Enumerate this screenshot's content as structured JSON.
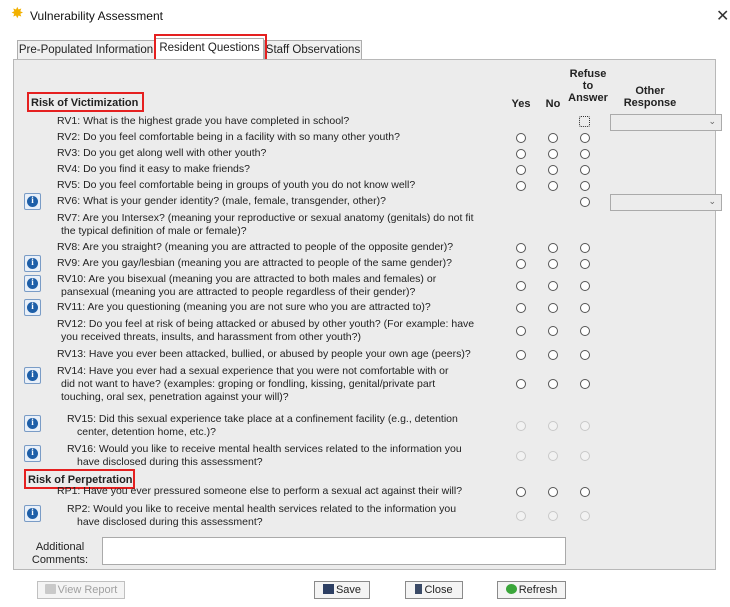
{
  "window": {
    "title": "Vulnerability Assessment",
    "close_glyph": "✕",
    "app_icon": "star-icon"
  },
  "tabs": [
    {
      "label": "Pre-Populated Information",
      "active": false
    },
    {
      "label": "Resident Questions",
      "active": true
    },
    {
      "label": "Staff Observations",
      "active": false
    }
  ],
  "columns": {
    "yes": "Yes",
    "no": "No",
    "refuse": "Refuse\nto\nAnswer",
    "other": "Other\nResponse"
  },
  "sections": {
    "victimization": "Risk of Victimization",
    "perpetration": "Risk of Perpetration"
  },
  "questions": [
    {
      "code": "RV1",
      "lines": [
        "RV1:  What is the highest grade you have completed in school?"
      ]
    },
    {
      "code": "RV2",
      "lines": [
        "RV2:  Do you feel comfortable being in a facility with so many other youth?"
      ]
    },
    {
      "code": "RV3",
      "lines": [
        "RV3:  Do you get along well with other youth?"
      ]
    },
    {
      "code": "RV4",
      "lines": [
        "RV4:  Do you find it easy to make friends?"
      ]
    },
    {
      "code": "RV5",
      "lines": [
        "RV5:  Do you feel comfortable being in groups of youth you do not know well?"
      ]
    },
    {
      "code": "RV6",
      "lines": [
        "RV6:  What is your gender identity? (male, female, transgender, other)?"
      ]
    },
    {
      "code": "RV7",
      "lines": [
        "RV7:  Are you Intersex? (meaning your reproductive or sexual anatomy (genitals) do not fit",
        "the typical definition of male or female)?"
      ]
    },
    {
      "code": "RV8",
      "lines": [
        "RV8:  Are you straight? (meaning you are attracted to people of the opposite gender)?"
      ]
    },
    {
      "code": "RV9",
      "lines": [
        "RV9:  Are you gay/lesbian (meaning you are attracted to people of the same gender)?"
      ]
    },
    {
      "code": "RV10",
      "lines": [
        "RV10: Are you bisexual (meaning you are attracted to both males and females) or",
        "pansexual (meaning you are attracted to people regardless of their gender)?"
      ]
    },
    {
      "code": "RV11",
      "lines": [
        "RV11: Are you questioning (meaning you are not sure who you are attracted to)?"
      ]
    },
    {
      "code": "RV12",
      "lines": [
        "RV12: Do you feel at risk of being attacked or abused by other youth? (For example: have",
        "you received threats, insults, and harassment from other youth?)"
      ]
    },
    {
      "code": "RV13",
      "lines": [
        "RV13: Have you ever been attacked, bullied, or abused by people your own age (peers)?"
      ]
    },
    {
      "code": "RV14",
      "lines": [
        "RV14: Have you ever had a sexual experience that you were not comfortable with or",
        "did not want to have?  (examples: groping or fondling, kissing, genital/private part",
        "touching, oral sex, penetration against your will)?"
      ]
    },
    {
      "code": "RV15",
      "lines": [
        "RV15: Did this sexual experience take place at a confinement facility (e.g., detention",
        "center, detention home, etc.)?"
      ]
    },
    {
      "code": "RV16",
      "lines": [
        "RV16: Would you like to receive mental health services related to the information you",
        "have disclosed during this assessment?"
      ]
    },
    {
      "code": "RP1",
      "lines": [
        "RP1:  Have you ever pressured someone else to perform a sexual act against their will?"
      ]
    },
    {
      "code": "RP2",
      "lines": [
        "RP2: Would you like to receive mental health services related to the information you",
        "have disclosed during this assessment?"
      ]
    }
  ],
  "info_glyph": "i",
  "comments": {
    "label": "Additional Comments:",
    "value": ""
  },
  "buttons": {
    "view_report": "View Report",
    "save": "Save",
    "close": "Close",
    "refresh": "Refresh"
  }
}
